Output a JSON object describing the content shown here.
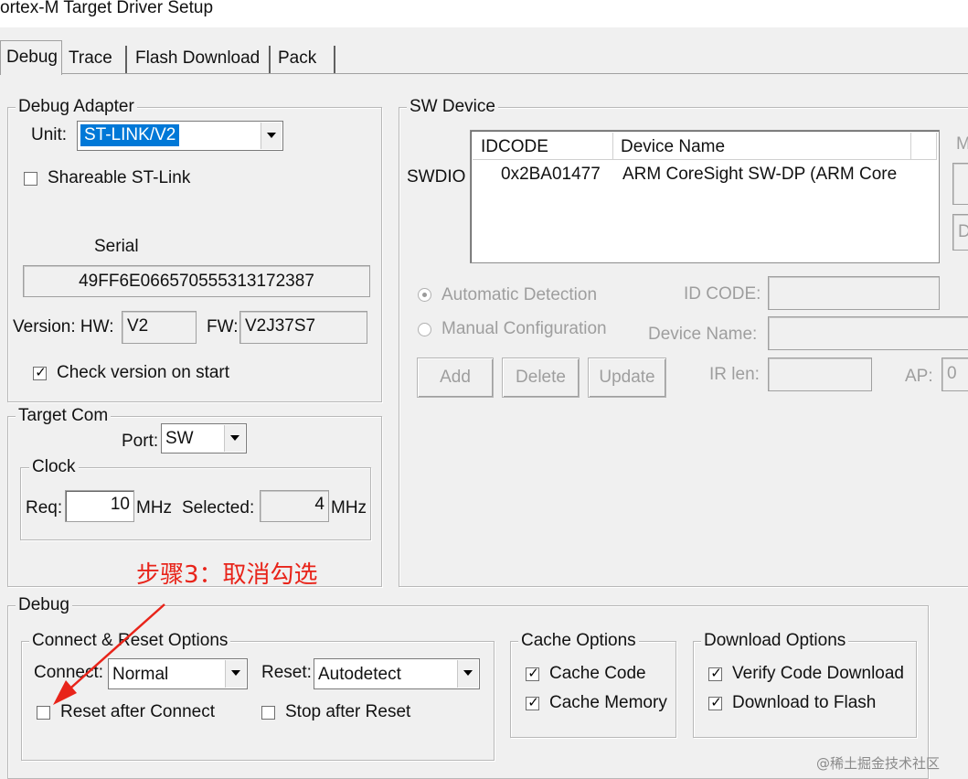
{
  "window": {
    "title": "ortex-M Target Driver Setup"
  },
  "tabs": [
    "Debug",
    "Trace",
    "Flash Download",
    "Pack"
  ],
  "debug_adapter": {
    "legend": "Debug Adapter",
    "unit_label": "Unit:",
    "unit_value": "ST-LINK/V2",
    "shareable_label": "Shareable ST-Link",
    "serial_label": "Serial",
    "serial_value": "49FF6E066570555313172387",
    "version_label": "Version: HW:",
    "hw_value": "V2",
    "fw_label": "FW:",
    "fw_value": "V2J37S7",
    "check_version_label": "Check version on start"
  },
  "target_com": {
    "legend": "Target Com",
    "port_label": "Port:",
    "port_value": "SW",
    "clock_legend": "Clock",
    "req_label": "Req:",
    "req_value": "10",
    "req_unit": "MHz",
    "selected_label": "Selected:",
    "selected_value": "4",
    "selected_unit": "MHz"
  },
  "sw_device": {
    "legend": "SW Device",
    "swdio_label": "SWDIO",
    "columns": [
      "IDCODE",
      "Device Name"
    ],
    "row": {
      "idcode": "0x2BA01477",
      "device_name": "ARM CoreSight SW-DP (ARM Core"
    },
    "auto_detect_label": "Automatic Detection",
    "manual_config_label": "Manual Configuration",
    "id_code_label": "ID CODE:",
    "device_name_label": "Device Name:",
    "add_label": "Add",
    "delete_label": "Delete",
    "update_label": "Update",
    "ir_len_label": "IR len:",
    "ap_label": "AP:",
    "ap_value": "0",
    "side_button_1": "M",
    "side_button_2": "D"
  },
  "annotation": {
    "text": "步骤3：取消勾选",
    "color": "#e8241a"
  },
  "debug": {
    "legend": "Debug",
    "connect_reset": {
      "legend": "Connect & Reset Options",
      "connect_label": "Connect:",
      "connect_value": "Normal",
      "reset_label": "Reset:",
      "reset_value": "Autodetect",
      "reset_after_connect_label": "Reset after Connect",
      "stop_after_reset_label": "Stop after Reset"
    },
    "cache_options": {
      "legend": "Cache Options",
      "cache_code_label": "Cache Code",
      "cache_memory_label": "Cache Memory"
    },
    "download_options": {
      "legend": "Download Options",
      "verify_label": "Verify Code Download",
      "download_flash_label": "Download to Flash"
    }
  },
  "watermark": "@稀土掘金技术社区",
  "colors": {
    "dialog_bg": "#f0f0f0",
    "selection": "#0078d7",
    "annotation": "#e8241a"
  }
}
